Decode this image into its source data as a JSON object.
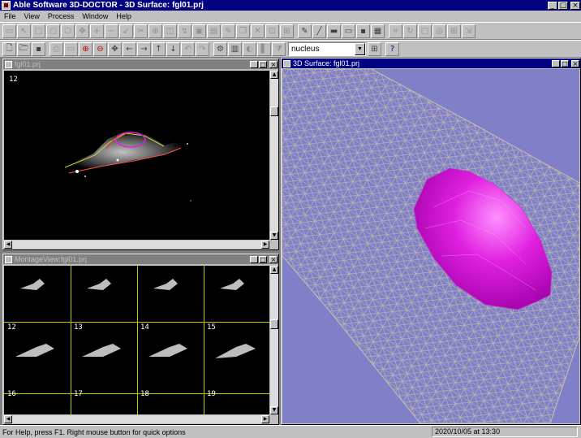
{
  "app": {
    "title": "Able Software 3D-DOCTOR - 3D Surface: fgl01.prj"
  },
  "menu": [
    "File",
    "View",
    "Process",
    "Window",
    "Help"
  ],
  "toolbar2": {
    "object_select_value": "nucleus"
  },
  "windows": {
    "image_view": {
      "title": "fgl01.prj",
      "slice_number": "12"
    },
    "montage_view": {
      "title": "MontageView:fgl01.prj",
      "frame_labels": [
        "12",
        "13",
        "14",
        "15",
        "16",
        "17",
        "18",
        "19"
      ]
    },
    "surface_view": {
      "title": "3D Surface: fgl01.prj"
    }
  },
  "status": {
    "message": "For Help, press F1. Right mouse button for quick options",
    "time": "2020/10/05 at 13:30"
  },
  "colors": {
    "title_active": "#000080",
    "surface_background": "#8080c8",
    "nucleus": "#e020e0",
    "mesh": "#c8c0a8"
  }
}
